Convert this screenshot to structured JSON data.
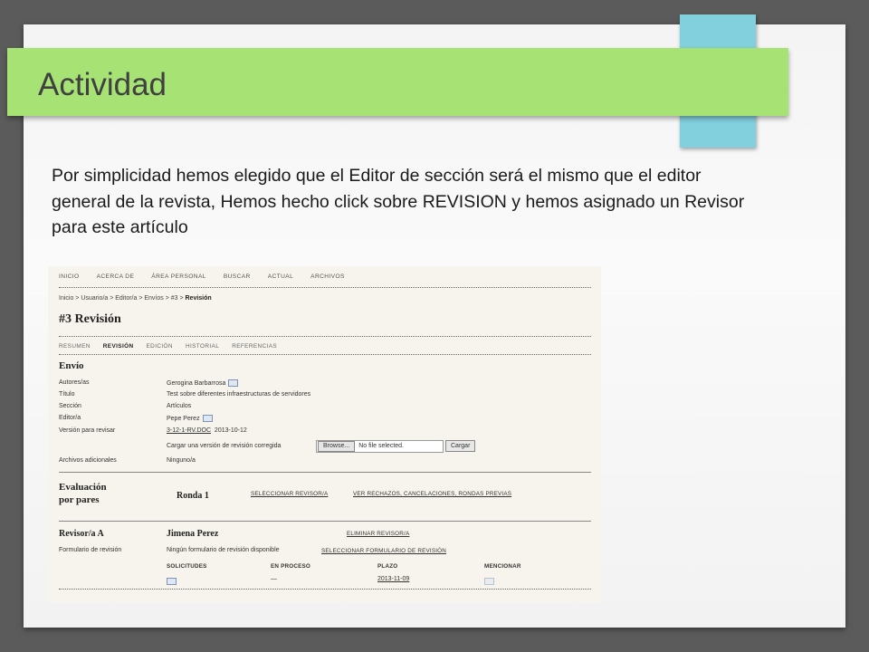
{
  "slide": {
    "title": "Actividad",
    "body": "Por simplicidad hemos elegido que el Editor de sección será el mismo que el editor general de la revista, Hemos hecho click sobre REVISION y hemos asignado un Revisor para este artículo"
  },
  "screenshot": {
    "nav": [
      "INICIO",
      "ACERCA DE",
      "ÁREA PERSONAL",
      "BUSCAR",
      "ACTUAL",
      "ARCHIVOS"
    ],
    "breadcrumb": {
      "path": "Inicio > Usuario/a > Editor/a > Envíos > #3 > ",
      "current": "Revisión"
    },
    "page_title": "#3 Revisión",
    "tabs": [
      "RESUMEN",
      "REVISIÓN",
      "EDICIÓN",
      "HISTORIAL",
      "REFERENCIAS"
    ],
    "active_tab": "REVISIÓN",
    "envio": {
      "heading": "Envío",
      "rows": [
        {
          "label": "Autores/as",
          "value": "Gerogina Barbarrosa"
        },
        {
          "label": "Título",
          "value": "Test sobre diferentes infraestructuras de servidores"
        },
        {
          "label": "Sección",
          "value": "Artículos"
        },
        {
          "label": "Editor/a",
          "value": "Pepe Perez"
        },
        {
          "label": "Versión para revisar",
          "value": "3-12-1-RV.DOC",
          "date": "2013-10-12"
        }
      ],
      "upload_label": "Cargar una versión de revisión corregida",
      "browse_button": "Browse...",
      "file_status": "No file selected.",
      "upload_button": "Cargar",
      "additional_label": "Archivos adicionales",
      "additional_value": "Ninguno/a"
    },
    "evaluacion": {
      "heading_line1": "Evaluación",
      "heading_line2": "por pares",
      "round": "Ronda 1",
      "select_reviewer": "SELECCIONAR REVISOR/A",
      "see_rejections": "VER RECHAZOS, CANCELACIONES, RONDAS PREVIAS"
    },
    "revisor": {
      "heading": "Revisor/a A",
      "name": "Jimena Perez",
      "remove_link": "ELIMINAR REVISOR/A",
      "form_label": "Formulario de revisión",
      "form_value": "Ningún formulario de revisión disponible",
      "select_form_link": "SELECCIONAR FORMULARIO DE REVISIÓN",
      "columns": [
        "SOLICITUDES",
        "EN PROCESO",
        "PLAZO",
        "MENCIONAR"
      ],
      "in_process": "—",
      "deadline": "2013-11-09"
    }
  },
  "colors": {
    "title_bar": "#a6e274",
    "accent_tab": "#82cfdd",
    "background": "#5b5b5b"
  }
}
